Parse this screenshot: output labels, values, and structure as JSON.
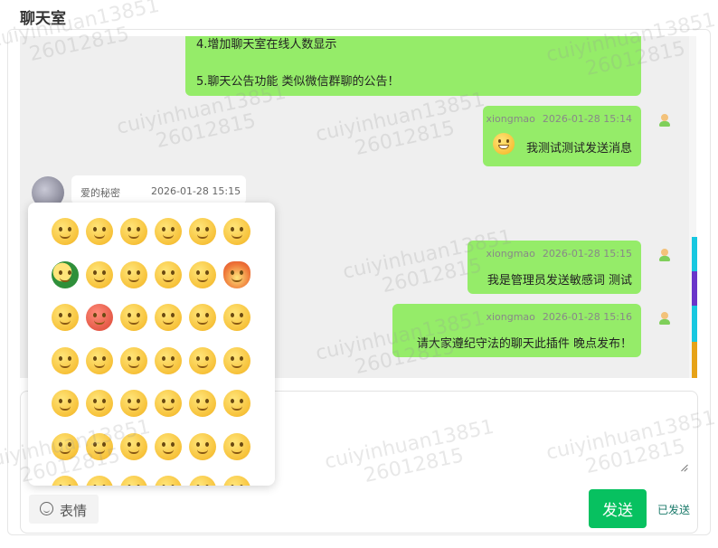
{
  "page": {
    "title": "聊天室"
  },
  "notice": {
    "line4": "4.增加聊天室在线人数显示",
    "line5": "5.聊天公告功能 类似微信群聊的公告！"
  },
  "messages": [
    {
      "user": "xiongmao",
      "time": "2026-01-28 15:14",
      "text": "我测试测试发送消息",
      "has_emoji": true
    },
    {
      "user": "爱的秘密",
      "time": "2026-01-28 15:15",
      "text": ""
    },
    {
      "user": "xiongmao",
      "time": "2026-01-28 15:15",
      "text": "我是管理员发送敏感词 测试"
    },
    {
      "user": "xiongmao",
      "time": "2026-01-28 15:16",
      "text": "请大家遵纪守法的聊天此插件 晚点发布！"
    }
  ],
  "composer": {
    "emoji_label": "表情",
    "send_label": "发送",
    "status": "已发送"
  },
  "watermark": {
    "line1": "cuiyinhuan13851",
    "line2": "26012815"
  },
  "colors": {
    "bubble_green": "#95ec69",
    "send_button": "#07c160",
    "status_text": "#1a7a6a"
  }
}
